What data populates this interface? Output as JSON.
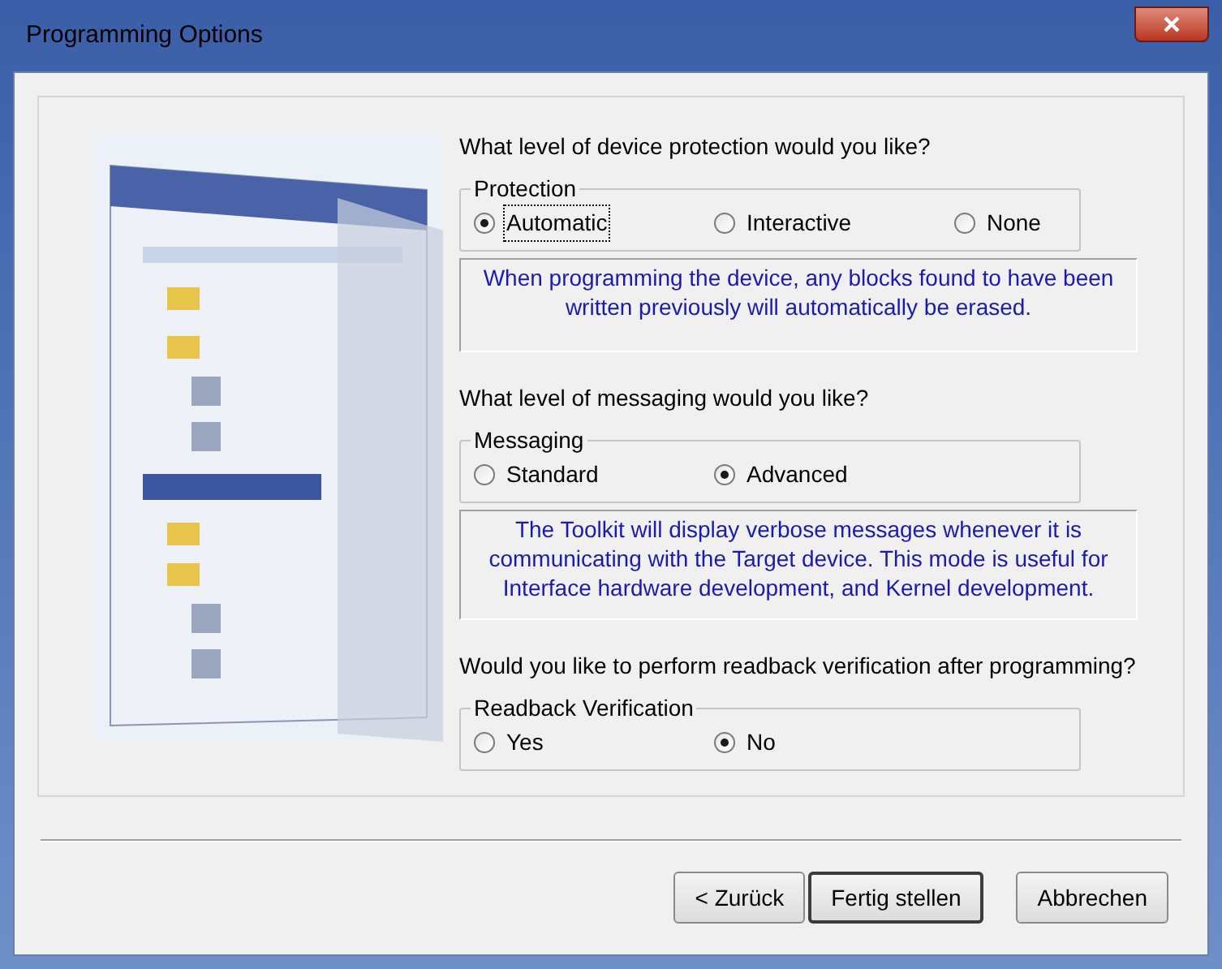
{
  "window": {
    "title": "Programming Options"
  },
  "sections": [
    {
      "question": "What level of device protection would you like?",
      "group": {
        "legend": "Protection",
        "options": [
          {
            "label": "Automatic",
            "selected": true,
            "focused": true
          },
          {
            "label": "Interactive",
            "selected": false,
            "focused": false
          },
          {
            "label": "None",
            "selected": false,
            "focused": false
          }
        ]
      },
      "info": "When programming the device, any blocks found to have been written previously will automatically be erased."
    },
    {
      "question": "What level of messaging would you like?",
      "group": {
        "legend": "Messaging",
        "options": [
          {
            "label": "Standard",
            "selected": false,
            "focused": false
          },
          {
            "label": "Advanced",
            "selected": true,
            "focused": false
          }
        ]
      },
      "info": "The Toolkit will display verbose messages whenever it is communicating with the Target device. This mode is useful for Interface hardware development, and Kernel development."
    },
    {
      "question": "Would you like to perform readback verification after programming?",
      "group": {
        "legend": "Readback Verification",
        "options": [
          {
            "label": "Yes",
            "selected": false,
            "focused": false
          },
          {
            "label": "No",
            "selected": true,
            "focused": false
          }
        ]
      }
    }
  ],
  "buttons": [
    {
      "label": "< Zurück",
      "default": false
    },
    {
      "label": "Fertig stellen",
      "default": true
    },
    {
      "label": "Abbrechen",
      "default": false
    }
  ]
}
